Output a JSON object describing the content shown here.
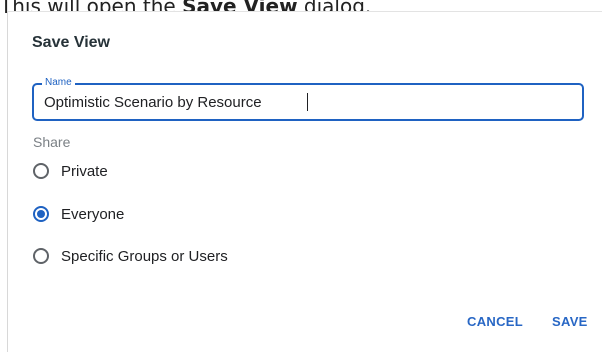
{
  "intro": {
    "prefix": "This will open the ",
    "bold": "Save View",
    "suffix": " dialog."
  },
  "dialog": {
    "title": "Save View",
    "name_field": {
      "label": "Name",
      "value": "Optimistic Scenario by Resource"
    },
    "share": {
      "label": "Share",
      "options": [
        {
          "label": "Private",
          "selected": false
        },
        {
          "label": "Everyone",
          "selected": true
        },
        {
          "label": "Specific Groups or Users",
          "selected": false
        }
      ]
    },
    "actions": {
      "cancel_label": "CANCEL",
      "save_label": "SAVE"
    }
  },
  "colors": {
    "accent": "#1f62c2",
    "button_text": "#2867c5",
    "muted_label": "#7b8085"
  }
}
